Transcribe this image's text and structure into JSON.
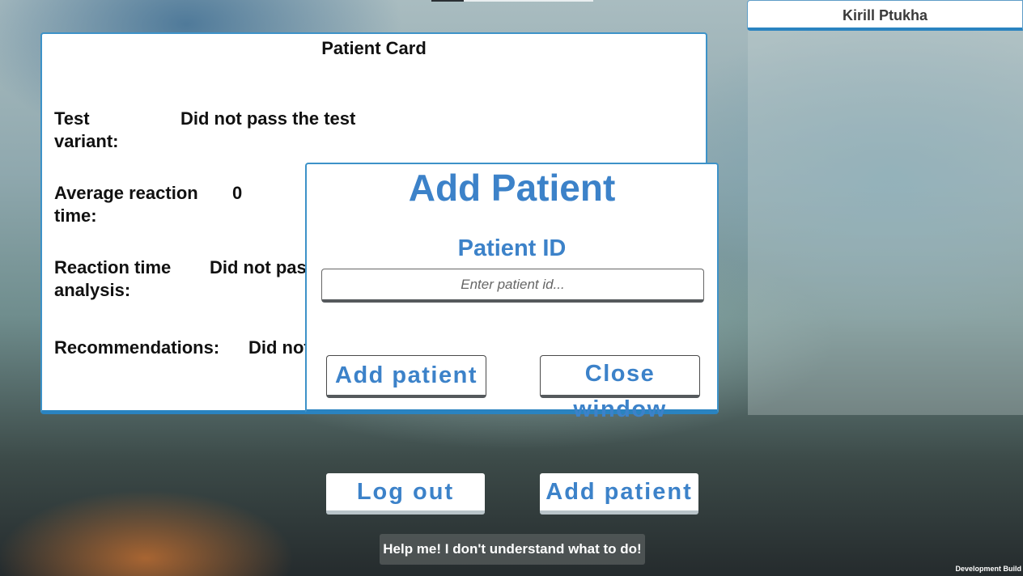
{
  "header": {
    "user_name": "Kirill Ptukha"
  },
  "patient_card": {
    "title": "Patient Card",
    "fields": [
      {
        "label_line1": "Test",
        "label_line2": "variant:",
        "value": "Did not pass the test"
      },
      {
        "label_line1": "Average reaction",
        "label_line2": "time:",
        "value": "0"
      },
      {
        "label_line1": "Reaction time",
        "label_line2": "analysis:",
        "value": "Did not pas"
      },
      {
        "label_line1": "Recommendations:",
        "label_line2": "",
        "value": "Did not"
      }
    ]
  },
  "add_patient_modal": {
    "title": "Add Patient",
    "id_label": "Patient ID",
    "id_placeholder": "Enter patient id...",
    "id_value": "",
    "add_button": "Add patient",
    "close_button": "Close window"
  },
  "footer": {
    "logout_button": "Log out",
    "add_patient_button": "Add patient",
    "help_button": "Help me! I don't understand what to do!",
    "build_label": "Development Build"
  },
  "colors": {
    "accent_blue": "#3c82c9",
    "border_blue": "#2a83c0"
  }
}
